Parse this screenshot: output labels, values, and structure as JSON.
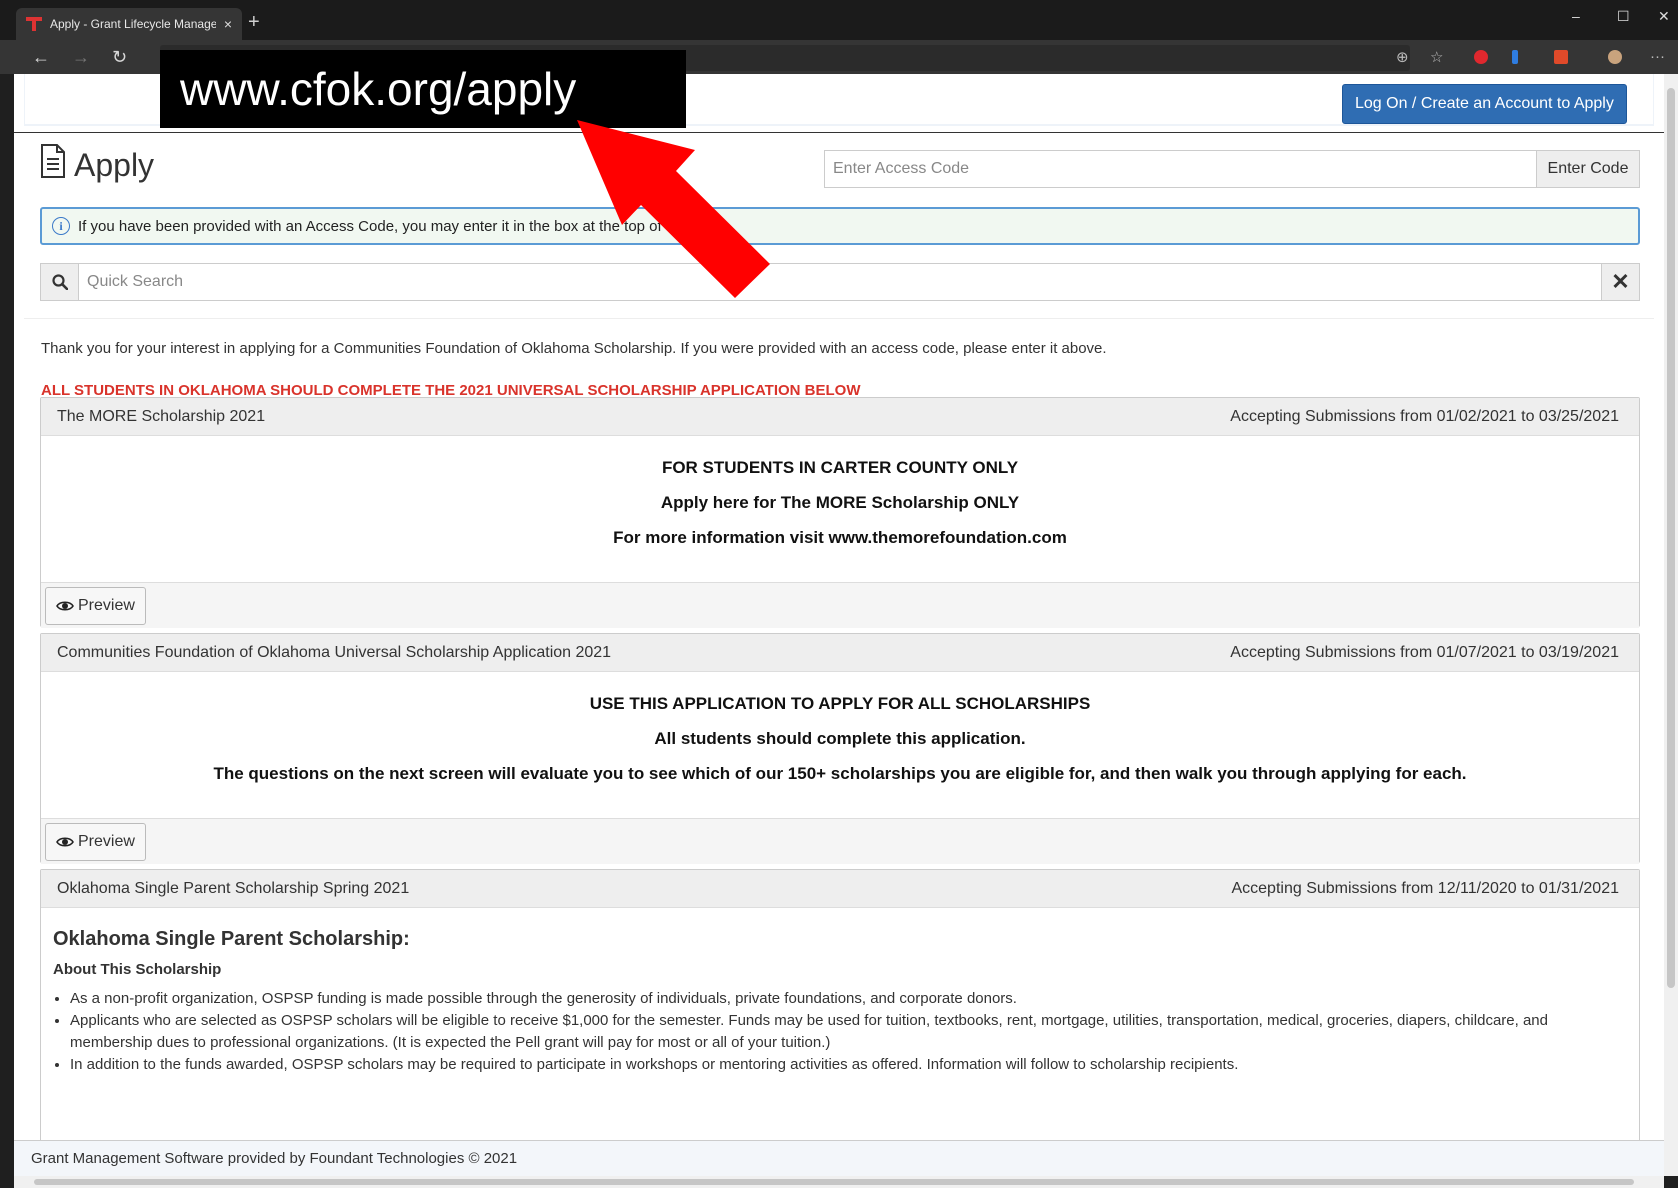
{
  "browser": {
    "tab_title": "Apply - Grant Lifecycle Manager",
    "tab_close": "×",
    "new_tab": "+",
    "minimize": "–",
    "maximize": "☐",
    "close": "✕",
    "back": "←",
    "forward": "→",
    "refresh": "↻",
    "zoom_icon": "⊕",
    "star_icon": "☆",
    "more_icon": "···"
  },
  "annotation": {
    "url_text": "www.cfok.org/apply",
    "arrow_color": "#ff0000"
  },
  "header": {
    "login_button": "Log On / Create an Account to Apply"
  },
  "page": {
    "title": "Apply",
    "access_code_placeholder": "Enter Access Code",
    "enter_code_button": "Enter Code",
    "info_message": "If you have been provided with an Access Code, you may enter it in the box at the top of the page.",
    "search_placeholder": "Quick Search",
    "clear_button": "✕",
    "intro_text": "Thank you for your interest in applying for a Communities Foundation of Oklahoma Scholarship. If you were provided with an access code, please enter it above.",
    "notice_text": "ALL STUDENTS IN OKLAHOMA SHOULD COMPLETE THE 2021 UNIVERSAL SCHOLARSHIP APPLICATION BELOW"
  },
  "opportunities": [
    {
      "name": "The MORE Scholarship 2021",
      "dates": "Accepting Submissions from 01/02/2021 to 03/25/2021",
      "lines": [
        "FOR STUDENTS IN CARTER COUNTY ONLY",
        "Apply here for The MORE Scholarship ONLY",
        "For more information visit www.themorefoundation.com"
      ],
      "preview_label": "Preview"
    },
    {
      "name": "Communities Foundation of Oklahoma Universal Scholarship Application 2021",
      "dates": "Accepting Submissions from 01/07/2021 to 03/19/2021",
      "lines": [
        "USE THIS APPLICATION TO APPLY FOR ALL SCHOLARSHIPS",
        "All students should complete this application.",
        "The questions on the next screen will evaluate you to see which of our 150+ scholarships you are eligible for, and then walk you through applying for each."
      ],
      "preview_label": "Preview"
    },
    {
      "name": "Oklahoma Single Parent Scholarship Spring 2021",
      "dates": "Accepting Submissions from 12/11/2020 to 01/31/2021",
      "heading": "Oklahoma Single Parent Scholarship:",
      "subheading": "About This Scholarship",
      "bullets": [
        "As a non-profit organization, OSPSP funding is made possible through the generosity of individuals, private foundations, and corporate donors.",
        "Applicants who are selected as OSPSP scholars will be eligible to receive $1,000 for the semester. Funds may be used for tuition, textbooks, rent, mortgage, utilities, transportation, medical, groceries, diapers, childcare, and membership dues to professional organizations. (It is expected the Pell grant will pay for most or all of your tuition.)",
        "In addition to the funds awarded, OSPSP scholars may be required to participate in workshops or mentoring activities as offered. Information will follow to scholarship recipients."
      ]
    }
  ],
  "footer": {
    "text": "Grant Management Software provided by Foundant Technologies © 2021"
  }
}
